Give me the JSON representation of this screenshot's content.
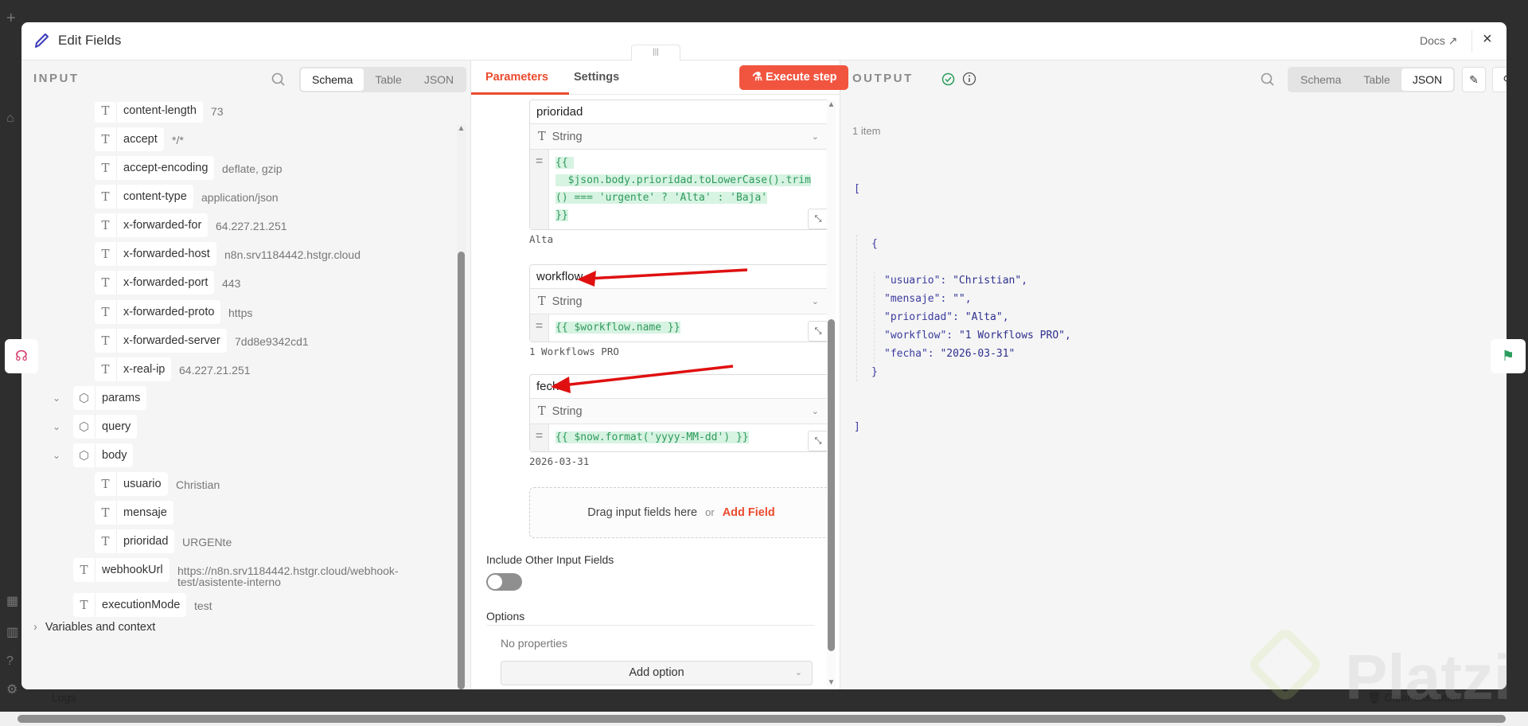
{
  "header": {
    "title": "Edit Fields",
    "docs_label": "Docs",
    "close_label": "×"
  },
  "input": {
    "title": "INPUT",
    "view_tabs": [
      "Schema",
      "Table",
      "JSON"
    ],
    "active_tab": "Schema",
    "tree": [
      {
        "level": 2,
        "type": "string",
        "key": "content-length",
        "value": "73"
      },
      {
        "level": 2,
        "type": "string",
        "key": "accept",
        "value": "*/*"
      },
      {
        "level": 2,
        "type": "string",
        "key": "accept-encoding",
        "value": "deflate, gzip"
      },
      {
        "level": 2,
        "type": "string",
        "key": "content-type",
        "value": "application/json"
      },
      {
        "level": 2,
        "type": "string",
        "key": "x-forwarded-for",
        "value": "64.227.21.251"
      },
      {
        "level": 2,
        "type": "string",
        "key": "x-forwarded-host",
        "value": "n8n.srv1184442.hstgr.cloud"
      },
      {
        "level": 2,
        "type": "string",
        "key": "x-forwarded-port",
        "value": "443"
      },
      {
        "level": 2,
        "type": "string",
        "key": "x-forwarded-proto",
        "value": "https"
      },
      {
        "level": 2,
        "type": "string",
        "key": "x-forwarded-server",
        "value": "7dd8e9342cd1"
      },
      {
        "level": 2,
        "type": "string",
        "key": "x-real-ip",
        "value": "64.227.21.251"
      },
      {
        "level": 1,
        "type": "object",
        "key": "params",
        "value": ""
      },
      {
        "level": 1,
        "type": "object",
        "key": "query",
        "value": ""
      },
      {
        "level": 1,
        "type": "object",
        "key": "body",
        "value": ""
      },
      {
        "level": 2,
        "type": "string",
        "key": "usuario",
        "value": "Christian"
      },
      {
        "level": 2,
        "type": "string",
        "key": "mensaje",
        "value": ""
      },
      {
        "level": 2,
        "type": "string",
        "key": "prioridad",
        "value": "URGENte"
      },
      {
        "level": 1,
        "type": "string",
        "key": "webhookUrl",
        "value": "https://n8n.srv1184442.hstgr.cloud/webhook-\ntest/asistente-interno"
      },
      {
        "level": 1,
        "type": "string",
        "key": "executionMode",
        "value": "test"
      }
    ],
    "variables_label": "Variables and context"
  },
  "params": {
    "tabs": [
      "Parameters",
      "Settings"
    ],
    "active_tab": "Parameters",
    "execute_label": "Execute step",
    "fields": [
      {
        "name": "prioridad",
        "type": "String",
        "expression_lines": [
          "{{ ",
          "  $json.body.prioridad.toLowerCase().trim",
          "() === 'urgente' ? 'Alta' : 'Baja'",
          "}}"
        ],
        "result": "Alta"
      },
      {
        "name": "workflow",
        "type": "String",
        "expression_lines": [
          "{{ $workflow.name }}"
        ],
        "result": "1 Workflows PRO"
      },
      {
        "name": "fecha",
        "type": "String",
        "expression_lines": [
          "{{ $now.format('yyyy-MM-dd') }}"
        ],
        "result": "2026-03-31"
      }
    ],
    "drag_text": "Drag input fields here",
    "or_text": "or",
    "add_field_label": "Add Field",
    "include_other_label": "Include Other Input Fields",
    "include_other_enabled": false,
    "options_label": "Options",
    "no_properties": "No properties",
    "add_option_label": "Add option"
  },
  "output": {
    "title": "OUTPUT",
    "view_tabs": [
      "Schema",
      "Table",
      "JSON"
    ],
    "active_tab": "JSON",
    "item_count": "1 item",
    "json_entries": [
      {
        "key": "\"usuario\"",
        "value": "\"Christian\""
      },
      {
        "key": "\"mensaje\"",
        "value": "\"\""
      },
      {
        "key": "\"prioridad\"",
        "value": "\"Alta\""
      },
      {
        "key": "\"workflow\"",
        "value": "\"1 Workflows PRO\""
      },
      {
        "key": "\"fecha\"",
        "value": "\"2026-03-31\""
      }
    ]
  },
  "footer": {
    "logs_label": "Logs",
    "clear_execution_label": "Clear execution"
  },
  "watermark": "Platzi",
  "colors": {
    "accent": "#ea4b2e",
    "execute_bg": "#f2553f",
    "success": "#2a9d5c",
    "arrow": "#e01010",
    "code_green": "#2e9a5c"
  }
}
